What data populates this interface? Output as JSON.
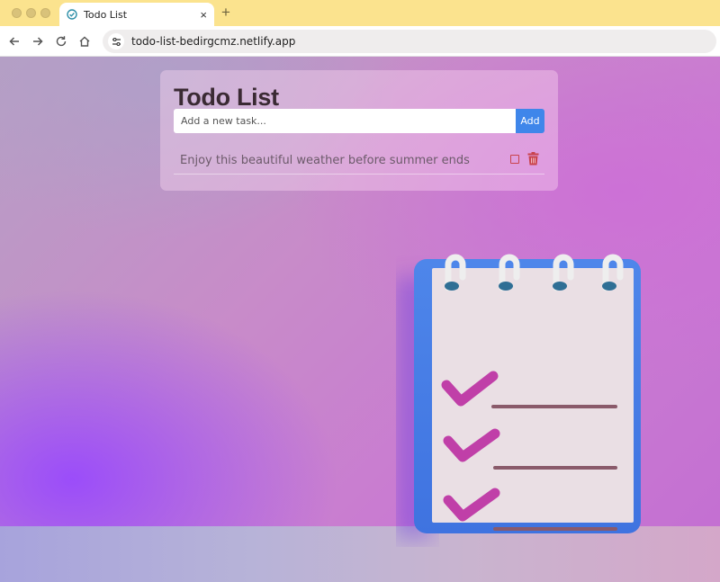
{
  "browser": {
    "tab": {
      "title": "Todo List",
      "close_icon": "×",
      "favicon": "check-circle-icon"
    },
    "new_tab_icon": "+",
    "address_bar": {
      "url": "todo-list-bedirgcmz.netlify.app"
    },
    "nav_icons": [
      "back-arrow-icon",
      "forward-arrow-icon",
      "reload-icon",
      "home-icon"
    ]
  },
  "app": {
    "title": "Todo List",
    "input": {
      "placeholder": "Add a new task...",
      "value": ""
    },
    "add_button_label": "Add",
    "tasks": [
      {
        "text": "Enjoy this beautiful weather before summer ends",
        "completed": false
      }
    ]
  },
  "colors": {
    "accent_button": "#3f86ea",
    "delete_icon": "#c9434c",
    "title_text": "#3a2a33",
    "browser_titlebar": "#fbe38e"
  }
}
